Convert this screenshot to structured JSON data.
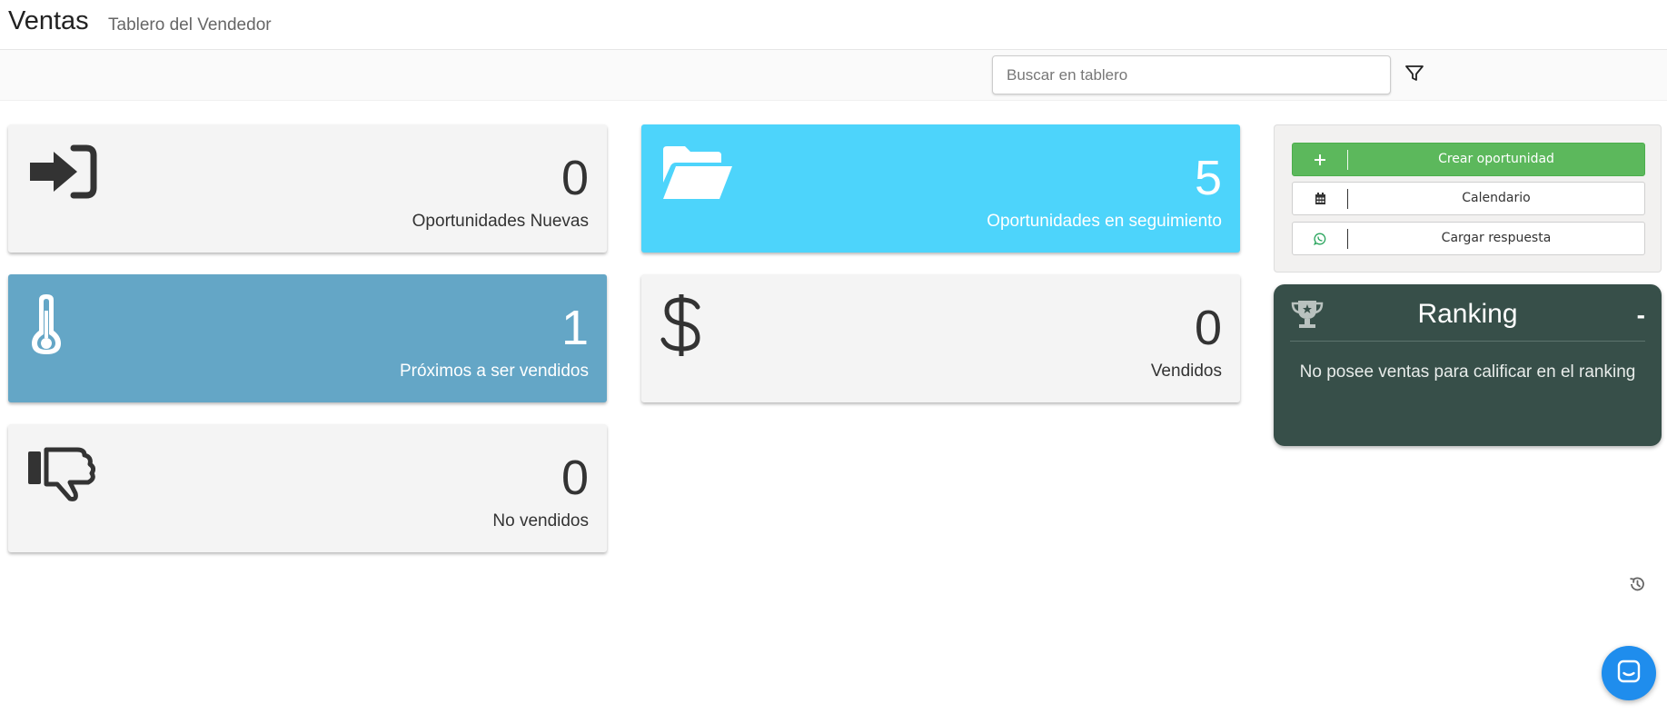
{
  "header": {
    "title": "Ventas",
    "subtitle": "Tablero del Vendedor"
  },
  "toolbar": {
    "search_placeholder": "Buscar en tablero",
    "search_value": ""
  },
  "cards": [
    {
      "value": "0",
      "label": "Oportunidades Nuevas",
      "icon": "sign-in-icon",
      "color": "#f4f4f4"
    },
    {
      "value": "5",
      "label": "Oportunidades en seguimiento",
      "icon": "folder-open-icon",
      "color": "#4dd4fb"
    },
    {
      "value": "1",
      "label": "Próximos a ser vendidos",
      "icon": "thermometer-icon",
      "color": "#64a6c6"
    },
    {
      "value": "0",
      "label": "Vendidos",
      "icon": "dollar-icon",
      "color": "#f4f4f4"
    },
    {
      "value": "0",
      "label": "No vendidos",
      "icon": "thumbs-down-icon",
      "color": "#f4f4f4"
    }
  ],
  "actions": [
    {
      "label": "Crear oportunidad",
      "icon": "plus-icon",
      "color": "#5cb85c"
    },
    {
      "label": "Calendario",
      "icon": "calendar-icon"
    },
    {
      "label": "Cargar respuesta",
      "icon": "whatsapp-icon"
    }
  ],
  "ranking": {
    "title": "Ranking",
    "position": "-",
    "message": "No posee ventas para calificar en el ranking",
    "color": "#374f49"
  }
}
